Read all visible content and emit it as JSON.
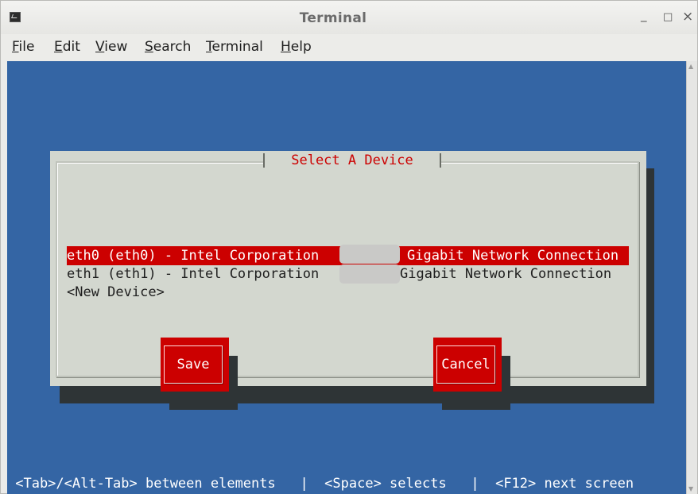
{
  "window": {
    "title": "Terminal",
    "controls": {
      "minimize": "_",
      "maximize": "□",
      "close": "×"
    }
  },
  "menu": [
    {
      "label": "File",
      "mnemonic": "F",
      "rest": "ile"
    },
    {
      "label": "Edit",
      "mnemonic": "E",
      "rest": "dit"
    },
    {
      "label": "View",
      "mnemonic": "V",
      "rest": "iew"
    },
    {
      "label": "Search",
      "mnemonic": "S",
      "rest": "earch"
    },
    {
      "label": "Terminal",
      "mnemonic": "T",
      "rest": "erminal"
    },
    {
      "label": "Help",
      "mnemonic": "H",
      "rest": "elp"
    }
  ],
  "dialog": {
    "title": "Select A Device",
    "devices": [
      {
        "left": "eth0 (eth0) - Intel Corporation",
        "right": "Gigabit Network Connection",
        "selected": true
      },
      {
        "left": "eth1 (eth1) - Intel Corporation",
        "right": "Gigabit Network Connection",
        "selected": false
      },
      {
        "left": "<New Device>",
        "right": "",
        "selected": false
      }
    ],
    "buttons": {
      "save": "Save",
      "cancel": "Cancel"
    }
  },
  "status_bar": {
    "text": " <Tab>/<Alt-Tab> between elements   |  <Space> selects   |  <F12> next screen"
  },
  "colors": {
    "terminal_bg": "#3465a4",
    "dialog_bg": "#d3d7cf",
    "accent_red": "#cc0000",
    "shadow": "#2e3436"
  }
}
